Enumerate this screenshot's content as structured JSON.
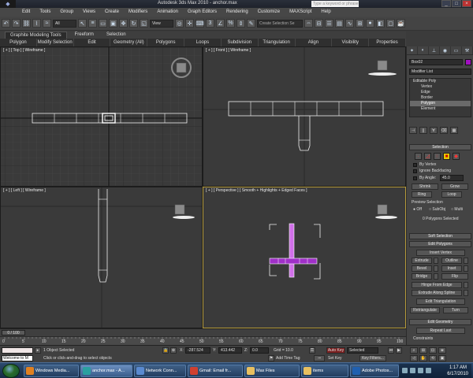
{
  "window": {
    "title": "Autodesk 3ds Max 2010",
    "file": "anchor.max",
    "search_placeholder": "Type a keyword or phrase",
    "minimize": "_",
    "maximize": "□",
    "close": "×"
  },
  "menu": [
    "Edit",
    "Tools",
    "Group",
    "Views",
    "Create",
    "Modifiers",
    "Animation",
    "Graph Editors",
    "Rendering",
    "Customize",
    "MAXScript",
    "Help"
  ],
  "toolbar": {
    "filter_value": "All",
    "refcoord_value": "View",
    "named_sel_placeholder": "Create Selection Se"
  },
  "ribbon": {
    "tabs": [
      {
        "label": "Graphite Modeling Tools",
        "active": true
      },
      {
        "label": "Freeform",
        "active": false
      },
      {
        "label": "Selection",
        "active": false
      }
    ],
    "tools": [
      "Polygon Modeling",
      "Modify Selection",
      "Edit",
      "Geometry (All)",
      "Polygons",
      "Loops",
      "Subdivision",
      "Triangulation",
      "Align",
      "Visibility",
      "Properties"
    ]
  },
  "viewports": {
    "top": "[ + ] [ Top ] [ Wireframe ]",
    "front": "[ + ] [ Front ] [ Wireframe ]",
    "left": "[ + ] [ Left ] [ Wireframe ]",
    "perspective": "[ + ] [ Perspective ] [ Smooth + Highlights + Edged Faces ]"
  },
  "command_panel": {
    "object_name": "Box02",
    "modifier_list": "Modifier List",
    "stack": [
      {
        "label": "Editable Poly",
        "level": 0,
        "selected": false
      },
      {
        "label": "Vertex",
        "level": 1,
        "selected": false
      },
      {
        "label": "Edge",
        "level": 1,
        "selected": false
      },
      {
        "label": "Border",
        "level": 1,
        "selected": false
      },
      {
        "label": "Polygon",
        "level": 1,
        "selected": true
      },
      {
        "label": "Element",
        "level": 1,
        "selected": false
      }
    ],
    "selection": {
      "title": "Selection",
      "by_vertex": "By Vertex",
      "ignore_backfacing": "Ignore Backfacing",
      "by_angle": "By Angle:",
      "angle_value": "45.0",
      "shrink": "Shrink",
      "grow": "Grow",
      "ring": "Ring",
      "loop": "Loop",
      "preview_title": "Preview Selection",
      "preview_off": "Off",
      "preview_subobj": "SubObj",
      "preview_multi": "Multi",
      "status": "0 Polygons Selected"
    },
    "soft_selection": "Soft Selection",
    "edit_polygons": {
      "title": "Edit Polygons",
      "insert_vertex": "Insert Vertex",
      "extrude": "Extrude",
      "outline": "Outline",
      "bevel": "Bevel",
      "inset": "Inset",
      "bridge": "Bridge",
      "flip": "Flip",
      "hinge": "Hinge From Edge",
      "extrude_spline": "Extrude Along Spline",
      "edit_triangulation": "Edit Triangulation",
      "retriangulate": "Retriangulate",
      "turn": "Turn"
    },
    "edit_geometry": {
      "title": "Edit Geometry",
      "repeat_last": "Repeat Last",
      "constraints": "Constraints"
    }
  },
  "timeline": {
    "slider": "0 / 100",
    "ticks": [
      0,
      5,
      10,
      15,
      20,
      25,
      30,
      35,
      40,
      45,
      50,
      55,
      60,
      65,
      70,
      75,
      80,
      85,
      90,
      95,
      100
    ]
  },
  "status": {
    "maxscript_text": "Welcome to M",
    "selected": "1 Object Selected",
    "prompt": "Click or click-and-drag to select objects",
    "x_label": "X:",
    "x_value": "-287.524",
    "y_label": "Y:",
    "y_value": "413.442",
    "z_label": "Z:",
    "z_value": "0.0",
    "grid": "Grid = 10.0",
    "add_time_tag": "Add Time Tag",
    "auto_key": "Auto Key",
    "selected_dropdown": "Selected",
    "set_key": "Set Key",
    "key_filters": "Key Filters..."
  },
  "taskbar": {
    "items": [
      {
        "label": "Windows Media...",
        "color": "#e08020",
        "active": false
      },
      {
        "label": "anchor.max - A...",
        "color": "#2aa0a0",
        "active": true
      },
      {
        "label": "Network Conn...",
        "color": "#5a8ad0",
        "active": false
      },
      {
        "label": "Gmail: Email fr...",
        "color": "#d04030",
        "active": false
      },
      {
        "label": "Max Files",
        "color": "#e8c060",
        "active": false
      },
      {
        "label": "items",
        "color": "#e8c060",
        "active": false
      },
      {
        "label": "Adobe Photos...",
        "color": "#2060b0",
        "active": false
      }
    ],
    "time": "1:17 AM",
    "date": "6/17/2010"
  }
}
